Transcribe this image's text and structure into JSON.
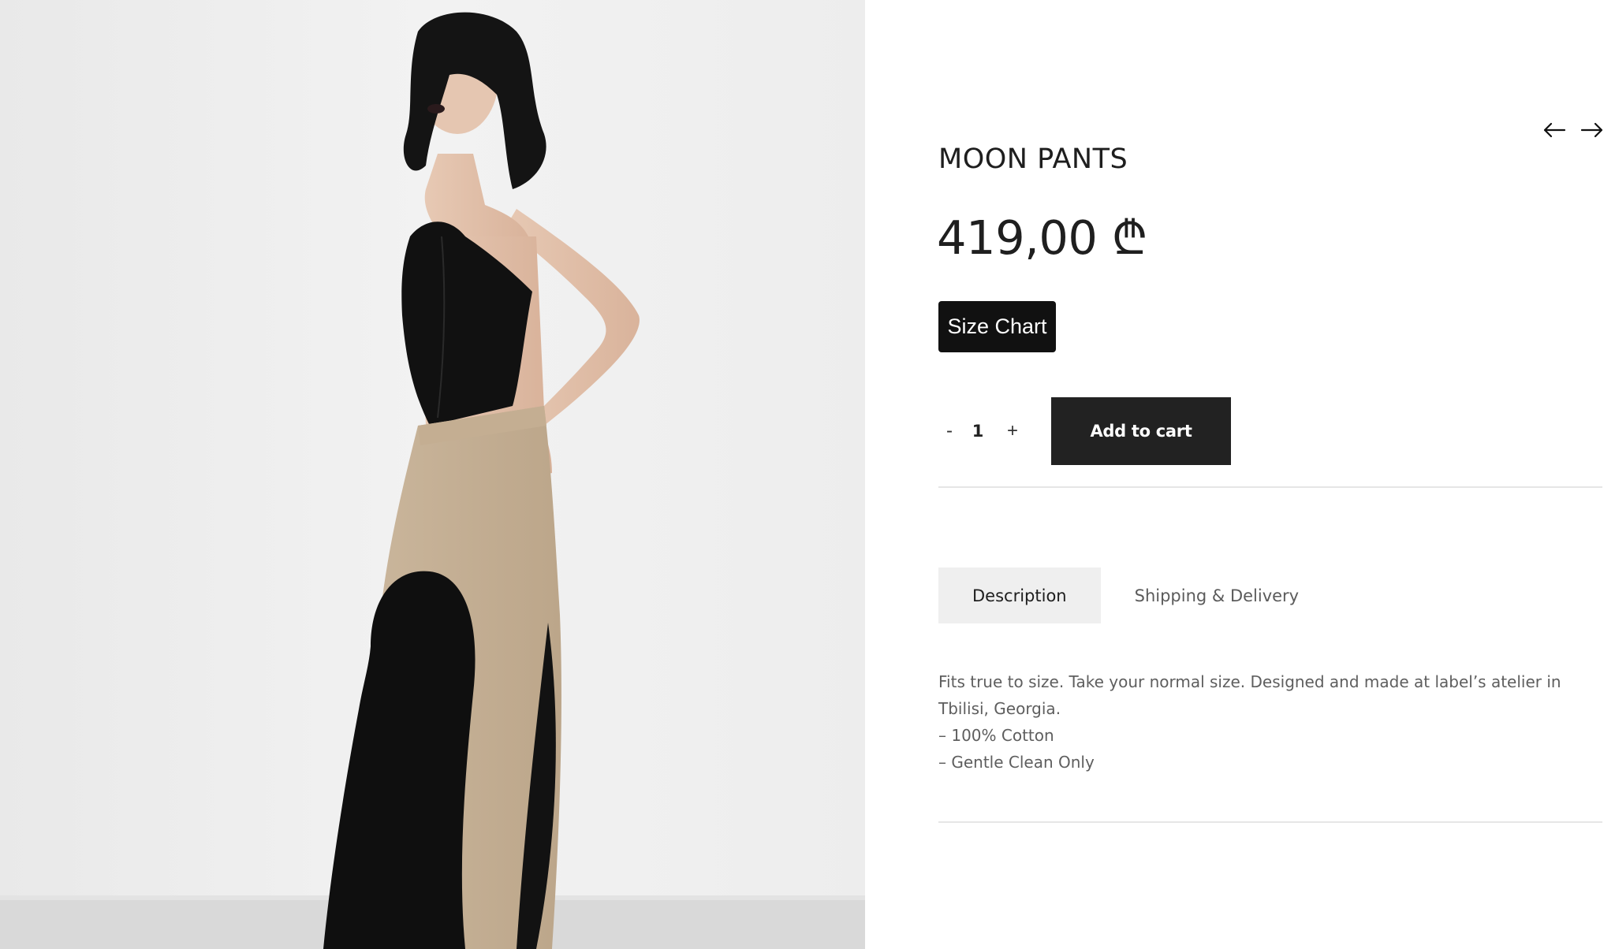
{
  "product": {
    "title": "MOON PANTS",
    "price": "419,00 ₾",
    "image_alt": "Model wearing black strapless corset top and black/beige moon pants"
  },
  "navigation": {
    "prev_icon": "arrow-left-icon",
    "next_icon": "arrow-right-icon"
  },
  "buttons": {
    "size_chart": "Size Chart",
    "add_to_cart": "Add to cart"
  },
  "quantity": {
    "minus": "-",
    "value": "1",
    "plus": "+"
  },
  "tabs": [
    {
      "label": "Description",
      "active": true
    },
    {
      "label": "Shipping & Delivery",
      "active": false
    }
  ],
  "description": {
    "intro": "Fits true to size. Take your normal size. Designed and made at label’s atelier in Tbilisi, Georgia.",
    "bullets": [
      "– 100% Cotton",
      "– Gentle Clean Only"
    ]
  },
  "colors": {
    "button_dark": "#222222",
    "size_chart_bg": "#111111",
    "active_tab_bg": "#efefef",
    "divider": "#e6e6e6"
  }
}
